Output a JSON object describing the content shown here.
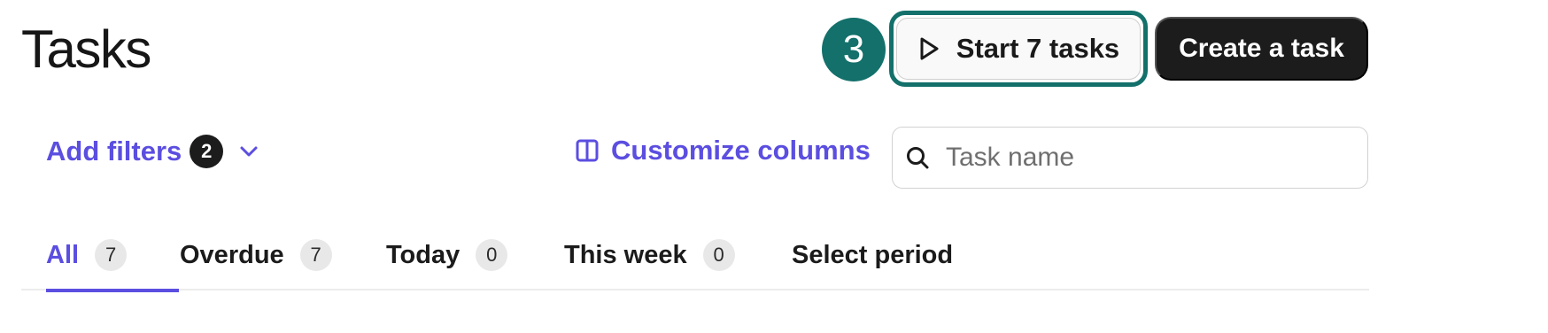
{
  "header": {
    "title": "Tasks",
    "step_number": "3",
    "start_button_label": "Start 7 tasks",
    "create_button_label": "Create a task"
  },
  "toolbar": {
    "add_filters_label": "Add filters",
    "filter_count": "2",
    "customize_columns_label": "Customize columns",
    "search_placeholder": "Task name"
  },
  "tabs": [
    {
      "label": "All",
      "count": "7",
      "active": true
    },
    {
      "label": "Overdue",
      "count": "7"
    },
    {
      "label": "Today",
      "count": "0"
    },
    {
      "label": "This week",
      "count": "0"
    },
    {
      "label": "Select period"
    }
  ],
  "colors": {
    "accent": "#5b4ee0",
    "step_badge": "#13706b",
    "primary_button": "#1c1c1c"
  },
  "icons": {
    "start_button": "play-icon",
    "filters": "chevron-down-icon",
    "customize": "columns-icon",
    "search": "search-icon"
  }
}
